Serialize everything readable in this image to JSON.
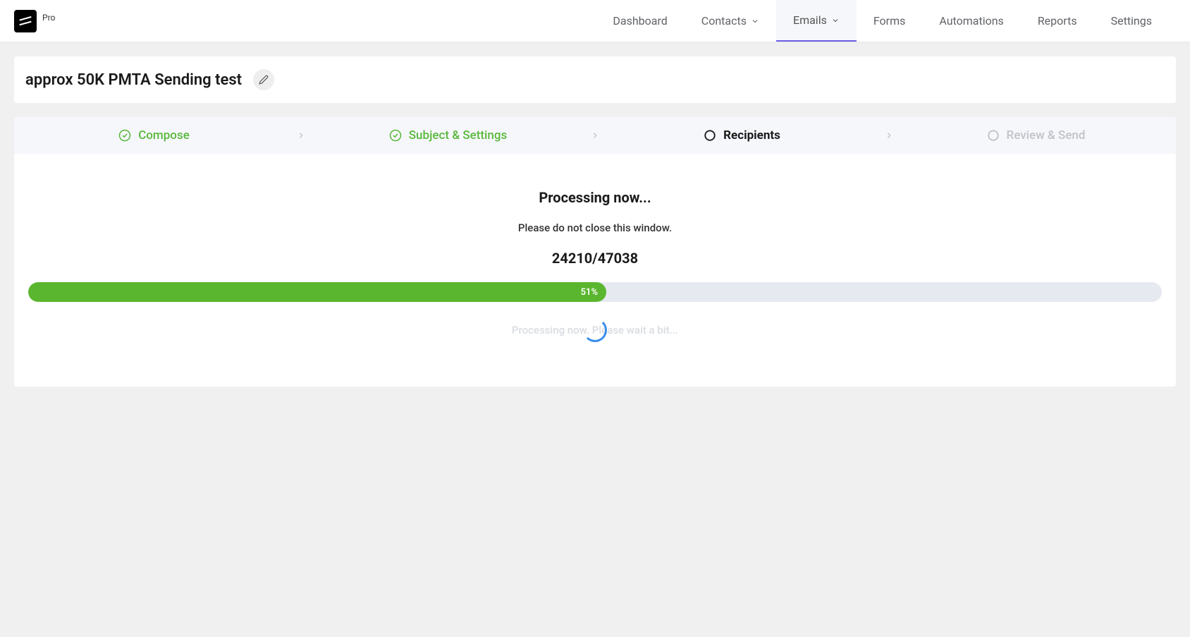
{
  "brand": {
    "pro_label": "Pro"
  },
  "nav": {
    "items": [
      {
        "label": "Dashboard",
        "has_dropdown": false,
        "active": false
      },
      {
        "label": "Contacts",
        "has_dropdown": true,
        "active": false
      },
      {
        "label": "Emails",
        "has_dropdown": true,
        "active": true
      },
      {
        "label": "Forms",
        "has_dropdown": false,
        "active": false
      },
      {
        "label": "Automations",
        "has_dropdown": false,
        "active": false
      },
      {
        "label": "Reports",
        "has_dropdown": false,
        "active": false
      },
      {
        "label": "Settings",
        "has_dropdown": false,
        "active": false
      }
    ]
  },
  "page": {
    "title": "approx 50K PMTA Sending test"
  },
  "steps": [
    {
      "label": "Compose",
      "state": "done"
    },
    {
      "label": "Subject & Settings",
      "state": "done"
    },
    {
      "label": "Recipients",
      "state": "current"
    },
    {
      "label": "Review & Send",
      "state": "pending"
    }
  ],
  "processing": {
    "title": "Processing now...",
    "subtitle": "Please do not close this window.",
    "current": 24210,
    "total": 47038,
    "counter_text": "24210/47038",
    "percent": 51,
    "percent_label": "51%",
    "wait_text": "Processing now. Please wait a bit..."
  },
  "colors": {
    "accent_green": "#5bb62f",
    "step_green": "#58b83b",
    "nav_active_border": "#6c5ce7",
    "spinner": "#3a8eea"
  }
}
